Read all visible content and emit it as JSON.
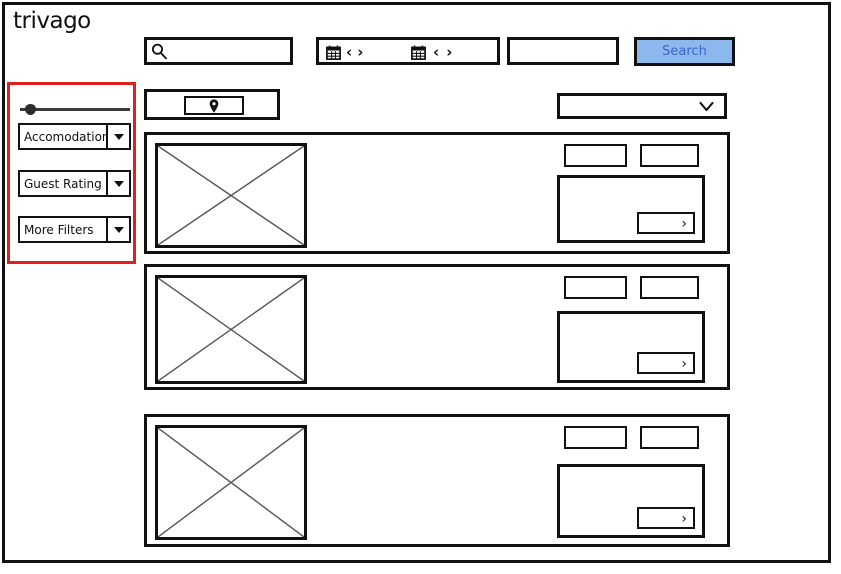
{
  "brand": {
    "logo_text": "trivago"
  },
  "search_bar": {
    "destination": {
      "value": "",
      "placeholder": "",
      "icon": "search-icon"
    },
    "dates": {
      "checkin": {
        "icon": "calendar-icon",
        "prev": "‹",
        "next": "›"
      },
      "checkout": {
        "icon": "calendar-icon",
        "prev": "‹",
        "next": "›"
      }
    },
    "guests": {
      "value": "",
      "placeholder": ""
    },
    "search_button": {
      "label": "Search",
      "fill_color": "#8cb8ee",
      "text_color": "#3a66c8"
    }
  },
  "filter_panel": {
    "highlight_color": "#e02020",
    "price_slider": {
      "icon": "slider-handle",
      "value_position_percent": 5
    },
    "dropdowns": [
      {
        "label": "Accomodation",
        "icon": "triangle-down-icon"
      },
      {
        "label": "Guest Rating",
        "icon": "triangle-down-icon"
      },
      {
        "label": "More Filters",
        "icon": "triangle-down-icon"
      }
    ]
  },
  "results_toolbar": {
    "map_toggle": {
      "icon": "map-pin-icon",
      "label": ""
    },
    "sort_select": {
      "value": "",
      "placeholder": "",
      "icon": "chevron-down-icon"
    }
  },
  "results": {
    "cards": [
      {
        "thumbnail": "image-placeholder",
        "tag_a": "",
        "tag_b": "",
        "price_panel": "",
        "deal_button": {
          "label": "",
          "icon": "chevron-right-icon"
        }
      },
      {
        "thumbnail": "image-placeholder",
        "tag_a": "",
        "tag_b": "",
        "price_panel": "",
        "deal_button": {
          "label": "",
          "icon": "chevron-right-icon"
        }
      },
      {
        "thumbnail": "image-placeholder",
        "tag_a": "",
        "tag_b": "",
        "price_panel": "",
        "deal_button": {
          "label": "",
          "icon": "chevron-right-icon"
        }
      }
    ]
  }
}
